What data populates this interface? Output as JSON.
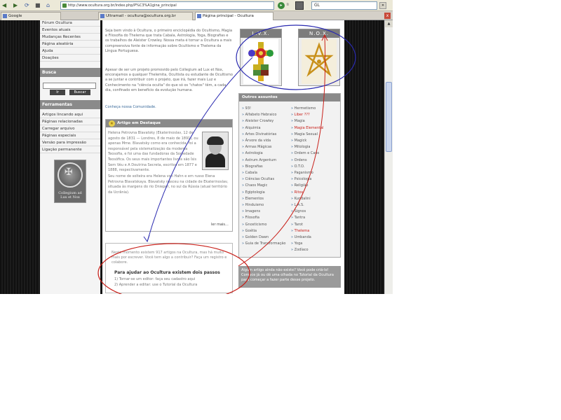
{
  "browser": {
    "url": "http://www.ocultura.org.br/index.php/P%C3%A1gina_principal",
    "misc_label": "li",
    "search_value": "GL",
    "search_go": "»",
    "go_icon": "arrow-right",
    "tabs": [
      {
        "label": "Google"
      },
      {
        "label": "Ultramail - ocultura@ocultura.org.br"
      },
      {
        "label": "Página principal - Ocultura"
      }
    ],
    "close_label": "x"
  },
  "sidebar": {
    "items_top": [
      "Fórum Ocultura",
      "Eventos atuais",
      "Mudanças Recentes",
      "Página aleatória",
      "Ajuda",
      "Doações"
    ],
    "search_heading": "Busca",
    "search_buttons": [
      "Ir",
      "Buscar"
    ],
    "tools_heading": "Ferramentas",
    "tools_items": [
      "Artigos lincando aqui",
      "Páginas relacionadas",
      "Carregar arquivo",
      "Páginas especiais",
      "Versão para impressão",
      "Ligação permanente"
    ],
    "badge_text": [
      "Collegium ad",
      "Lux et Nox"
    ]
  },
  "content": {
    "intro": "Seja bem vindo à Ocultura, o primeiro enciclopédia do Ocultismo, Magia e Filosofia do Thelema que trata Cabala, Astrologia, Yoga, Biografias e os trabalhos de Aleister Crowley. Nossa meta é tornar a Ocultura a mais compreensiva fonte de informação sobre Ocultismo e Thelema da Língua Portuguesa.",
    "intro2": "Apesar de ser um projeto promovido pelo Collegium ad Lux et Nox, encorajamos a qualquer Thelemita, Ocultista ou estudante de Ocultismo a se juntar e contribuir com o projeto, que irá, fazer mais Luz e Conhecimento na \"ciência oculta\" do que só os \"chatos\" têm, a cada dia, confinado em benefício da evolução humana.",
    "community_line": "Conheça nossa Comunidade.",
    "featured": {
      "heading": "Artigo em Destaque",
      "text1": "Helena Petrovna Blavatsky (Ekaterinoslav, 12 de agosto de 1831 — Londres, 8 de maio de 1891), ou apenas Mme. Blavatsky como era conhecida, foi a responsável pela sistematização da moderna Teosofia, e foi uma das fundadoras da Sociedade Teosófica. Os seus mais importantes livros são Ísis Sem Véu e A Doutrina Secreta, escritos em 1877 e 1888, respectivamente.",
      "text2": "Seu nome de solteira era Helena von Hahn e em russo Elena Petrovna Blavatskaya. Blavatsky nasceu na cidade de Ekaterinoslav, situada às margens do rio Dnieper, no sul da Rússia (atual território da Ucrânia).",
      "read_more": "ler mais..."
    },
    "bottom": {
      "text": "Neste momento existem 917 artigos na Ocultura, mas há muito mais por escrever. Você tem algo a contribuir? Faça um registro e colabore.",
      "help_title": "Para ajudar ao Ocultura existem dois passos",
      "help_items": [
        "1) Tornar-se um editor: faça seu cadastro aqui",
        "2) Aprender a editar: use o Tutorial da Ocultura"
      ]
    }
  },
  "right": {
    "symbols": [
      {
        "title": "L.V.X.",
        "icon": "rose-cross-icon"
      },
      {
        "title": "N.O.X.",
        "icon": "unicursal-hexagram-icon"
      }
    ],
    "themes_heading": "Outros assuntos",
    "themes_left": [
      "93!",
      "Alfabeto Hebraico",
      "Aleister Crowley",
      "Alquimia",
      "Artes Divinatórias",
      "Árvore da vida",
      "Armas Mágicas",
      "Astrologia",
      "Astrum Argentum",
      "Biografias",
      "Cabala",
      "Ciências Ocultas",
      "Chaos Magic",
      "Egiptologia",
      "Elementos",
      "Hinduismo",
      "Imagens",
      "Filosofia",
      "Gnosticismo",
      "Goétia",
      "Golden Dawn",
      "Guia de Transformação"
    ],
    "themes_right": [
      "Hermetismo",
      "Liber ???",
      "Magia",
      "Magia Elemental",
      "Magia Sexual",
      "Magick",
      "Mitologia",
      "Ordem e Caos",
      "Ordens",
      "O.T.O.",
      "Paganismo",
      "Psicologia",
      "Religião",
      "Ritos",
      "Kundalini",
      "L.A.S.",
      "Signos",
      "Tantra",
      "Tarot",
      "Thelema",
      "Umbanda",
      "Yoga",
      "Zodíaco"
    ],
    "note": "Algum artigo ainda não existe? Você pode criá-lo! Comece já ou dê uma olhada no Tutorial da Ocultura para começar a fazer parte desse projeto."
  },
  "colors": {
    "annotation": "#c8201a",
    "annotation_blue": "#2a2ab0"
  }
}
